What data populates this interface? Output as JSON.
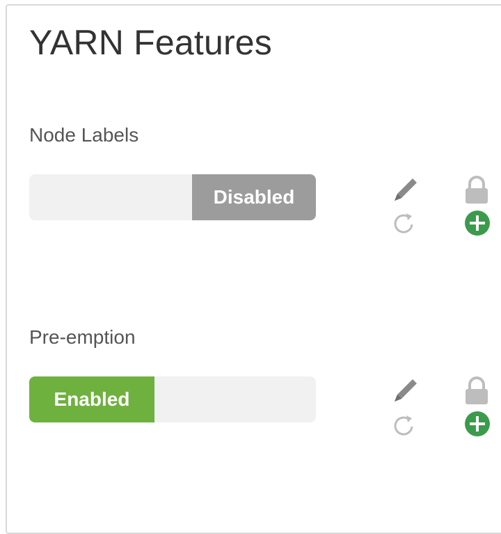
{
  "panel": {
    "title": "YARN Features"
  },
  "features": [
    {
      "label": "Node Labels",
      "toggle_state": "off",
      "toggle_text": "Disabled",
      "icons": [
        "pencil-icon",
        "lock-icon",
        "refresh-icon",
        "plus-circle-icon"
      ]
    },
    {
      "label": "Pre-emption",
      "toggle_state": "on",
      "toggle_text": "Enabled",
      "icons": [
        "pencil-icon",
        "lock-icon",
        "refresh-icon",
        "plus-circle-icon"
      ]
    }
  ],
  "colors": {
    "enabled": "#6fb13f",
    "disabled": "#9c9c9c",
    "track": "#f1f1f1",
    "add_icon": "#3c9a4c",
    "muted_icon": "#bdbdbd",
    "pencil_icon": "#8a8a8a"
  }
}
